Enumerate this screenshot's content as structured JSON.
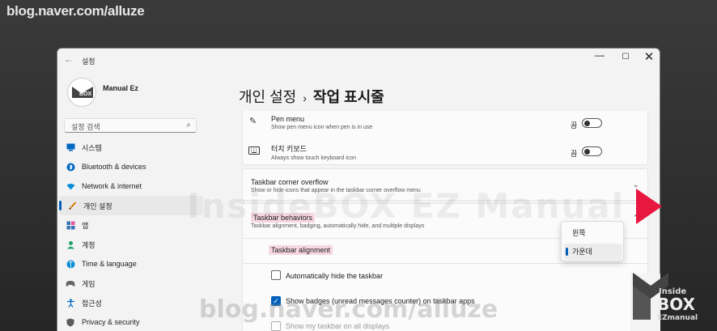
{
  "overlay": {
    "blog_url": "blog.naver.com/alluze",
    "watermark_text": "InsideBOX EZ Manual",
    "bottom_watermark": "blog.naver.com/alluze",
    "brand_line1": "Inside",
    "brand_line2": "BOX",
    "brand_line3": "EZmanual"
  },
  "window": {
    "title": "설정",
    "back_icon": "back-arrow-icon",
    "controls": [
      "minimize-icon",
      "maximize-icon",
      "close-icon"
    ]
  },
  "profile": {
    "name": "Manual Ez",
    "avatar_text": "BOX"
  },
  "search": {
    "placeholder": "설정 검색",
    "icon": "search-icon"
  },
  "sidebar": {
    "items": [
      {
        "label": "시스템",
        "icon": "monitor-icon",
        "color": "#0067c0"
      },
      {
        "label": "Bluetooth & devices",
        "icon": "bluetooth-icon",
        "color": "#0067c0"
      },
      {
        "label": "Network & internet",
        "icon": "wifi-icon",
        "color": "#0a8dd6"
      },
      {
        "label": "개인 설정",
        "icon": "brush-icon",
        "color": "#d77b00",
        "active": true
      },
      {
        "label": "앱",
        "icon": "apps-icon",
        "color": "#3b6fb6"
      },
      {
        "label": "계정",
        "icon": "account-icon",
        "color": "#1aa36a"
      },
      {
        "label": "Time & language",
        "icon": "globe-icon",
        "color": "#0a8dd6"
      },
      {
        "label": "게임",
        "icon": "gamepad-icon",
        "color": "#666666"
      },
      {
        "label": "접근성",
        "icon": "accessibility-icon",
        "color": "#0067c0"
      },
      {
        "label": "Privacy & security",
        "icon": "shield-icon",
        "color": "#5a5a5a"
      }
    ]
  },
  "header": {
    "parent": "개인 설정",
    "separator": "›",
    "current": "작업 표시줄"
  },
  "pen_menu": {
    "title": "Pen menu",
    "subtitle": "Show pen menu icon when pen is in use",
    "toggle_label": "끔"
  },
  "touch_keyboard": {
    "title": "터치 키보드",
    "subtitle": "Always show touch keyboard icon",
    "toggle_label": "끔"
  },
  "corner_overflow": {
    "title": "Taskbar corner overflow",
    "subtitle": "Show or hide icons that appear in the taskbar corner overflow menu"
  },
  "behaviors": {
    "title": "Taskbar behaviors",
    "subtitle": "Taskbar alignment, badging, automatically hide, and multiple displays",
    "alignment_label": "Taskbar alignment",
    "auto_hide": {
      "label": "Automatically hide the taskbar",
      "checked": false
    },
    "badges": {
      "label": "Show badges (unread messages counter) on taskbar apps",
      "checked": true
    },
    "all_displays": {
      "label": "Show my taskbar on all displays",
      "checked": false
    }
  },
  "alignment_dropdown": {
    "options": [
      "왼쪽",
      "가운데"
    ],
    "selected": "가운데"
  },
  "colors": {
    "accent": "#005fb8",
    "pointer_arrow": "#e8173f",
    "highlight": "#f5b5c8"
  }
}
